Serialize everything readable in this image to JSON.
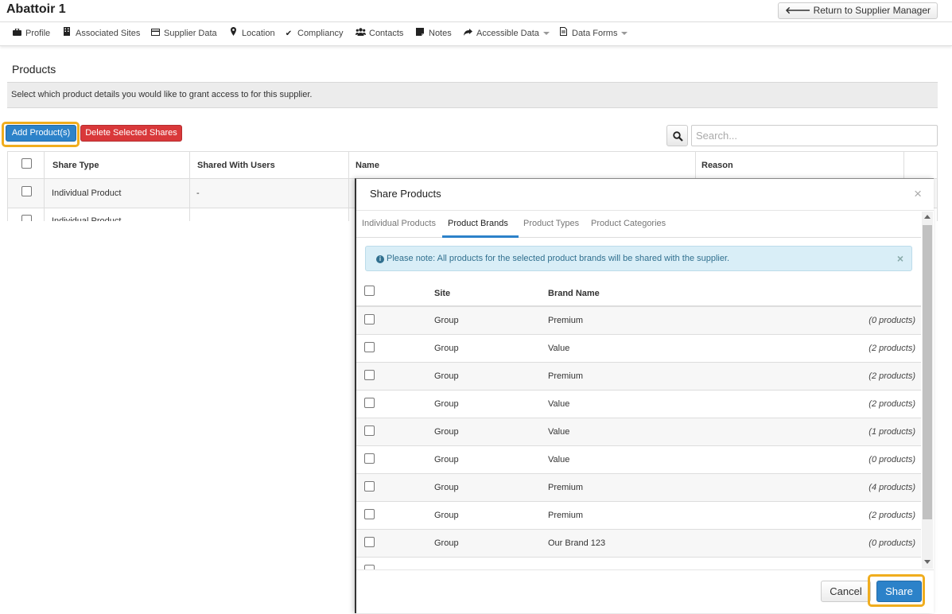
{
  "header": {
    "title": "Abattoir 1",
    "return_label": "Return to Supplier Manager"
  },
  "nav": {
    "items": [
      {
        "label": "Profile",
        "icon": "briefcase-icon"
      },
      {
        "label": "Associated Sites",
        "icon": "building-icon"
      },
      {
        "label": "Supplier Data",
        "icon": "card-icon"
      },
      {
        "label": "Location",
        "icon": "map-marker-icon"
      },
      {
        "label": "Compliancy",
        "icon": "check-icon"
      },
      {
        "label": "Contacts",
        "icon": "users-icon"
      },
      {
        "label": "Notes",
        "icon": "note-icon"
      },
      {
        "label": "Accessible Data",
        "icon": "share-icon"
      },
      {
        "label": "Data Forms",
        "icon": "file-icon"
      }
    ]
  },
  "products": {
    "title": "Products",
    "description": "Select which product details you would like to grant access to for this supplier.",
    "add_label": "Add Product(s)",
    "delete_label": "Delete Selected Shares",
    "search_placeholder": "Search...",
    "columns": [
      "Share Type",
      "Shared With Users",
      "Name",
      "Reason"
    ],
    "rows": [
      {
        "share_type": "Individual Product",
        "shared_with": "-"
      },
      {
        "share_type": "Individual Product",
        "shared_with": ""
      }
    ]
  },
  "modal": {
    "title": "Share Products",
    "close": "×",
    "tabs": [
      "Individual Products",
      "Product Brands",
      "Product Types",
      "Product Categories"
    ],
    "active_tab": "Product Brands",
    "alert": "Please note: All products for the selected product brands will be shared with the supplier.",
    "alert_close": "×",
    "columns": [
      "Site",
      "Brand Name"
    ],
    "rows": [
      {
        "site": "Group",
        "brand": "Premium",
        "count": "(0 products)"
      },
      {
        "site": "Group",
        "brand": "Value",
        "count": "(2 products)"
      },
      {
        "site": "Group",
        "brand": "Premium",
        "count": "(2 products)"
      },
      {
        "site": "Group",
        "brand": "Value",
        "count": "(2 products)"
      },
      {
        "site": "Group",
        "brand": "Value",
        "count": "(1 products)"
      },
      {
        "site": "Group",
        "brand": "Value",
        "count": "(0 products)"
      },
      {
        "site": "Group",
        "brand": "Premium",
        "count": "(4 products)"
      },
      {
        "site": "Group",
        "brand": "Premium",
        "count": "(2 products)"
      },
      {
        "site": "Group",
        "brand": "Our Brand 123",
        "count": "(0 products)"
      }
    ],
    "cancel_label": "Cancel",
    "share_label": "Share"
  },
  "colors": {
    "primary": "#2c82c9",
    "danger": "#d9383a",
    "highlight": "#f0ad1e",
    "info_bg": "#d9eef7"
  }
}
